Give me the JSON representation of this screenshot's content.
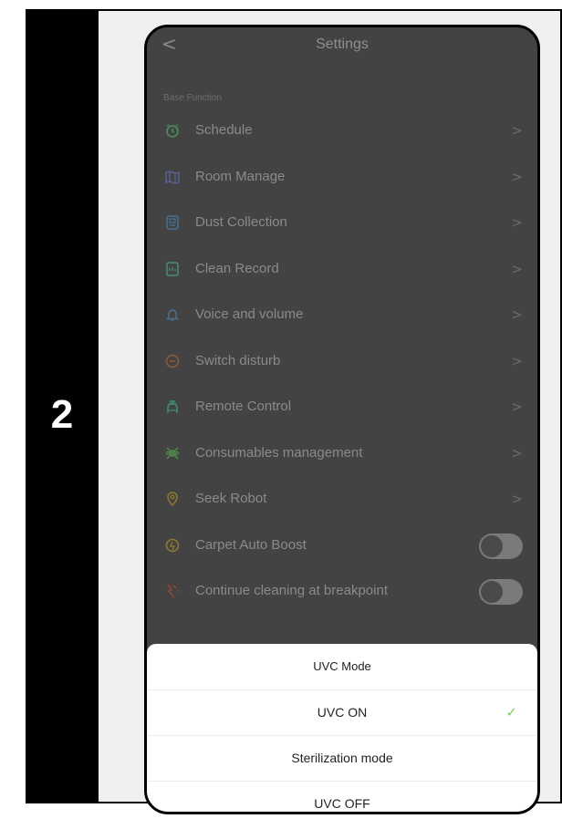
{
  "step": {
    "number": "2"
  },
  "header": {
    "back_icon": "chevron-left-icon",
    "title": "Settings"
  },
  "section_title": "Base Function",
  "items": [
    {
      "label": "Schedule",
      "icon": "clock-icon",
      "color": "#4c8f5f",
      "control": "chevron"
    },
    {
      "label": "Room Manage",
      "icon": "map-icon",
      "color": "#5b5f8f",
      "control": "chevron"
    },
    {
      "label": "Dust Collection",
      "icon": "dust-bin-icon",
      "color": "#4a6f8f",
      "control": "chevron"
    },
    {
      "label": "Clean Record",
      "icon": "record-icon",
      "color": "#4c8f6f",
      "control": "chevron"
    },
    {
      "label": "Voice and volume",
      "icon": "bell-icon",
      "color": "#4a6f8f",
      "control": "chevron"
    },
    {
      "label": "Switch disturb",
      "icon": "minus-circle-icon",
      "color": "#8f5a3a",
      "control": "chevron"
    },
    {
      "label": "Remote Control",
      "icon": "remote-icon",
      "color": "#3f8f73",
      "control": "chevron"
    },
    {
      "label": "Consumables management",
      "icon": "consumables-icon",
      "color": "#4e8f4a",
      "control": "chevron"
    },
    {
      "label": "Seek Robot",
      "icon": "location-pin-icon",
      "color": "#8f7a2f",
      "control": "chevron"
    },
    {
      "label": "Carpet Auto Boost",
      "icon": "boost-icon",
      "color": "#8f7a2f",
      "control": "toggle",
      "on": false
    },
    {
      "label": "Continue cleaning at breakpoint",
      "icon": "breakpoint-icon",
      "color": "#8f4a2f",
      "control": "toggle",
      "on": false
    }
  ],
  "chevron_glyph": ">",
  "sheet": {
    "title": "UVC Mode",
    "options": [
      {
        "label": "UVC ON",
        "selected": true
      },
      {
        "label": "Sterilization mode",
        "selected": false
      },
      {
        "label": "UVC OFF",
        "selected": false
      }
    ],
    "check_glyph": "✓",
    "check_color": "#7ccf5a"
  }
}
